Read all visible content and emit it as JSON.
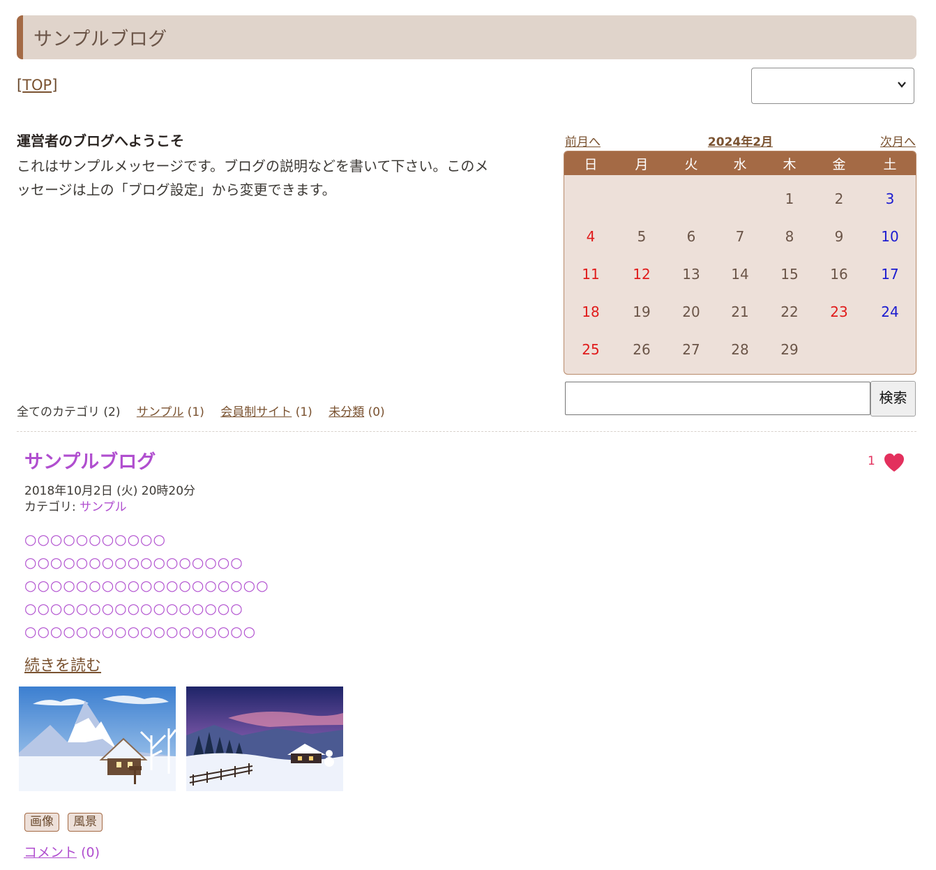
{
  "header": {
    "title": "サンプルブログ"
  },
  "nav": {
    "bracket_open": "[",
    "top_label": "TOP",
    "bracket_close": "]",
    "select_value": ""
  },
  "intro": {
    "heading": "運営者のブログへようこそ",
    "line1": "これはサンプルメッセージです。ブログの説明などを書いて下さい。このメ",
    "line2": "ッセージは上の「ブログ設定」から変更できます。"
  },
  "calendar": {
    "prev_label": "前月へ",
    "month_label": "2024年2月",
    "next_label": "次月へ",
    "weekdays": [
      "日",
      "月",
      "火",
      "水",
      "木",
      "金",
      "土"
    ],
    "days": [
      "1",
      "2",
      "3",
      "4",
      "5",
      "6",
      "7",
      "8",
      "9",
      "10",
      "11",
      "12",
      "13",
      "14",
      "15",
      "16",
      "17",
      "18",
      "19",
      "20",
      "21",
      "22",
      "23",
      "24",
      "25",
      "26",
      "27",
      "28",
      "29"
    ],
    "sunday_color": "#e01b1b",
    "saturday_color": "#1c1cd0",
    "holiday_color": "#e01b1b",
    "header_color": "#a46a45"
  },
  "search": {
    "button_label": "検索",
    "value": ""
  },
  "categories": {
    "all": "全てのカテゴリ (2)",
    "items": [
      {
        "label": "サンプル",
        "count": "(1)"
      },
      {
        "label": "会員制サイト",
        "count": "(1)"
      },
      {
        "label": "未分類",
        "count": "(0)"
      }
    ]
  },
  "post": {
    "title": "サンプルブログ",
    "likes": "1",
    "date": "2018年10月2日 (火) 20時20分",
    "category_prefix": "カテゴリ: ",
    "category": "サンプル",
    "body": [
      "○○○○○○○○○○○",
      "○○○○○○○○○○○○○○○○○",
      "○○○○○○○○○○○○○○○○○○○",
      "○○○○○○○○○○○○○○○○○",
      "○○○○○○○○○○○○○○○○○○"
    ],
    "read_more": "続きを読む",
    "tags": [
      "画像",
      "風景"
    ],
    "comments_label": "コメント",
    "comments_count": "(0)"
  },
  "colors": {
    "accent": "#a46a45",
    "link": "#7a5230",
    "post_purple": "#b04ecf",
    "heart": "#e3305d"
  }
}
